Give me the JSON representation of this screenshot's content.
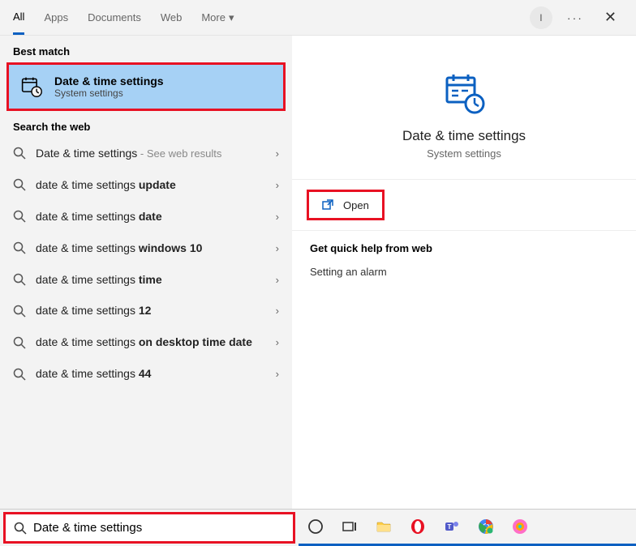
{
  "header": {
    "tabs": [
      "All",
      "Apps",
      "Documents",
      "Web",
      "More"
    ],
    "active_tab": 0,
    "avatar_initial": "I"
  },
  "left": {
    "best_match_label": "Best match",
    "best_match": {
      "title": "Date & time settings",
      "subtitle": "System settings"
    },
    "search_web_label": "Search the web",
    "web_results": [
      {
        "prefix": "Date & time settings",
        "bold": "",
        "suffix": "",
        "hint": " - See web results"
      },
      {
        "prefix": "date & time settings ",
        "bold": "update",
        "suffix": "",
        "hint": ""
      },
      {
        "prefix": "date & time settings ",
        "bold": "date",
        "suffix": "",
        "hint": ""
      },
      {
        "prefix": "date & time settings ",
        "bold": "windows 10",
        "suffix": "",
        "hint": ""
      },
      {
        "prefix": "date & time settings ",
        "bold": "time",
        "suffix": "",
        "hint": ""
      },
      {
        "prefix": "date & time settings ",
        "bold": "12",
        "suffix": "",
        "hint": ""
      },
      {
        "prefix": "date & time settings ",
        "bold": "on desktop time date",
        "suffix": "",
        "hint": ""
      },
      {
        "prefix": "date & time settings ",
        "bold": "44",
        "suffix": "",
        "hint": ""
      }
    ]
  },
  "right": {
    "title": "Date & time settings",
    "subtitle": "System settings",
    "open_label": "Open",
    "help_label": "Get quick help from web",
    "help_items": [
      "Setting an alarm"
    ]
  },
  "search": {
    "value": "Date & time settings"
  },
  "colors": {
    "accent": "#0b60c1",
    "highlight_border": "#e81123",
    "selected_bg": "#a6d1f5"
  }
}
